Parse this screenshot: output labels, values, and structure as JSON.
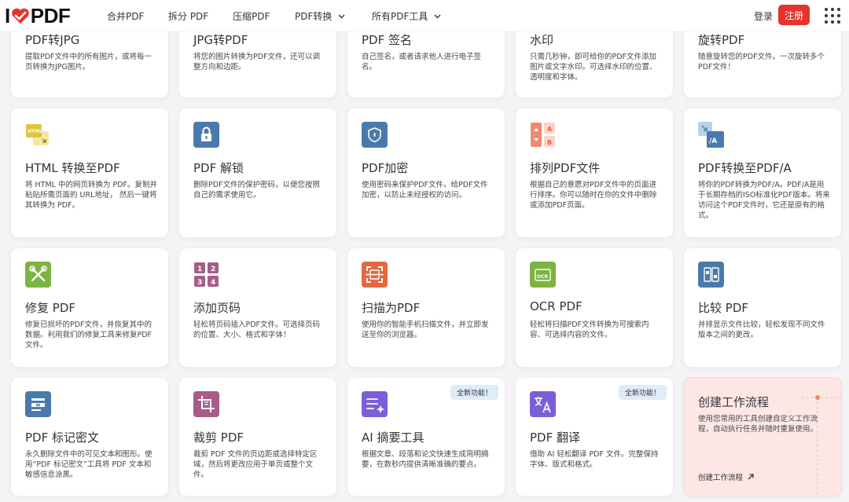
{
  "header": {
    "logo_left": "I",
    "logo_right": "PDF",
    "nav": [
      {
        "label": "合并PDF"
      },
      {
        "label": "拆分 PDF"
      },
      {
        "label": "压缩PDF"
      },
      {
        "label": "PDF转换"
      },
      {
        "label": "所有PDF工具"
      }
    ],
    "login": "登录",
    "signup": "注册"
  },
  "tools": [
    {
      "title": "PDF转JPG",
      "desc": "提取PDF文件中的所有图片，或将每一页转换为JPG图片。"
    },
    {
      "title": "JPG转PDF",
      "desc": "将您的图片转换为PDF文件，还可以调整方向和边距。"
    },
    {
      "title": "PDF 签名",
      "desc": "自己签名，或者请求他人进行电子签名。"
    },
    {
      "title": "水印",
      "desc": "只需几秒钟，即可给你的PDF文件添加图片或文字水印。可选择水印的位置、透明度和字体。"
    },
    {
      "title": "旋转PDF",
      "desc": "随意旋转您的PDF文件。一次旋转多个PDF文件！"
    },
    {
      "title": "HTML 转换至PDF",
      "desc": "将 HTML 中的网页转换为 PDF。复制并粘贴所需页面的 URL地址， 然后一键将其转换为 PDF。",
      "icon": "html-to-pdf-icon",
      "icon_text": "HTML",
      "color": "#e0c43b"
    },
    {
      "title": "PDF 解锁",
      "desc": "删除PDF文件的保护密码，以便您按照自己的需求使用它。",
      "icon": "unlock-icon",
      "color": "#4a7aab"
    },
    {
      "title": "PDF加密",
      "desc": "使用密码来保护PDF文件。给PDF文件加密，以防止未经授权的访问。",
      "icon": "shield-icon",
      "color": "#4a7aab"
    },
    {
      "title": "排列PDF文件",
      "desc": "根据自己的意愿对PDF文件中的页面进行排序。你可以随时在你的文件中删除或添加PDF页面。",
      "icon": "organize-pages-icon",
      "icon_a": "A",
      "icon_b": "B",
      "color": "#f08a6f"
    },
    {
      "title": "PDF转换至PDF/A",
      "desc": "将你的PDF转换为PDF/A。PDF/A是用于长期存档的ISO标准化PDF版本。将来访问这个PDF文件时，它还是原有的格式。",
      "icon": "pdfa-icon",
      "icon_text": "/A",
      "color": "#4a7aab"
    },
    {
      "title": "修复 PDF",
      "desc": "修复已损坏的PDF文件，并恢复其中的数据。利用我们的修复工具来修复PDF文件。",
      "icon": "repair-tools-icon",
      "color": "#7cb342"
    },
    {
      "title": "添加页码",
      "desc": "轻松将页码插入PDF文件。可选择页码的位置、大小、格式和字体！",
      "icon": "page-numbers-icon",
      "digits": [
        "1",
        "2",
        "3",
        "4"
      ],
      "color": "#a85c8a"
    },
    {
      "title": "扫描为PDF",
      "desc": "使用你的智能手机扫描文件，并立即发送至你的浏览器。",
      "icon": "scan-icon",
      "color": "#e5673f"
    },
    {
      "title": "OCR PDF",
      "desc": "轻松将扫描PDF文件转换为可搜索内容、可选择内容的文件。",
      "icon": "ocr-icon",
      "icon_text": "OCR",
      "color": "#7cb342"
    },
    {
      "title": "比较 PDF",
      "desc": "并排显示文件比较，轻松发现不同文件版本之间的更改。",
      "icon": "compare-icon",
      "color": "#4a7aab"
    },
    {
      "title": "PDF 标记密文",
      "desc": "永久删除文件中的可见文本和图形。使用“PDF 标记密文”工具将 PDF 文本和敏感信息涂黑。",
      "icon": "redact-icon",
      "color": "#4a7aab"
    },
    {
      "title": "裁剪 PDF",
      "desc": "裁剪 PDF 文件的页边距或选择特定区域，然后将更改应用于单页或整个文件。",
      "icon": "crop-icon",
      "color": "#a85c8a"
    },
    {
      "title": "AI 摘要工具",
      "desc": "根据文章、段落和论文快速生成简明摘要，在数秒内提供清晰准确的要点。",
      "icon": "ai-summary-icon",
      "badge": "全新功能！",
      "color": "#7b5fd6"
    },
    {
      "title": "PDF 翻译",
      "desc": "借助 AI 轻松翻译 PDF 文件。完整保持字体、版式和格式。",
      "icon": "translate-icon",
      "badge": "全新功能！",
      "color": "#7b5fd6"
    }
  ],
  "workflow": {
    "title": "创建工作流程",
    "desc": "使用您常用的工具创建自定义工作流程，自动执行任务并随时重复使用。",
    "link": "创建工作流程"
  }
}
